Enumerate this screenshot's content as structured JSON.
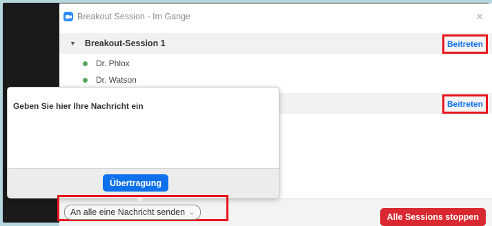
{
  "window": {
    "title": "Breakout Session - Im Gange"
  },
  "sessions": [
    {
      "name": "Breakout-Session 1",
      "join_label": "Beitreten",
      "participants": [
        "Dr. Phlox",
        "Dr. Watson"
      ]
    },
    {
      "name": "",
      "join_label": "Beitreten",
      "participants": []
    }
  ],
  "broadcast_popup": {
    "placeholder": "Geben Sie hier Ihre Nachricht ein",
    "send_label": "Übertragung"
  },
  "footer": {
    "message_all_label": "An alle eine Nachricht senden",
    "stop_all_label": "Alle Sessions stoppen"
  },
  "colors": {
    "accent_blue": "#0e71eb",
    "stop_red": "#d9282f",
    "highlight_red": "#e8121c",
    "participant_green": "#53a85a"
  }
}
